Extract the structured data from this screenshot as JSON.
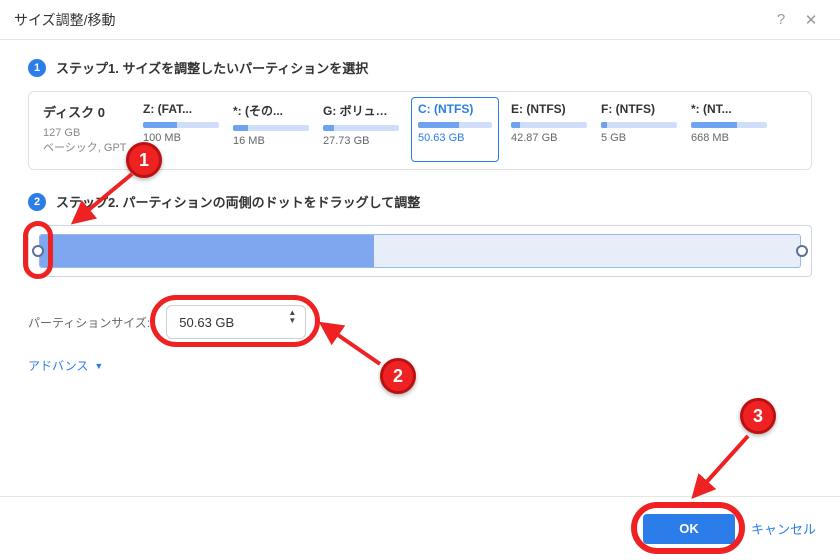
{
  "window": {
    "title": "サイズ調整/移動"
  },
  "step1": {
    "num": "1",
    "label": "ステップ1. サイズを調整したいパーティションを選択"
  },
  "disk": {
    "name": "ディスク 0",
    "size": "127 GB",
    "type": "ベーシック, GPT"
  },
  "partitions": [
    {
      "label": "Z: (FAT...",
      "size": "100 MB",
      "fill": 45
    },
    {
      "label": "*: (その...",
      "size": "16 MB",
      "fill": 20
    },
    {
      "label": "G: ボリューム(...",
      "size": "27.73 GB",
      "fill": 15
    },
    {
      "label": "C: (NTFS)",
      "size": "50.63 GB",
      "fill": 55,
      "selected": true
    },
    {
      "label": "E: (NTFS)",
      "size": "42.87 GB",
      "fill": 12
    },
    {
      "label": "F: (NTFS)",
      "size": "5 GB",
      "fill": 8
    },
    {
      "label": "*: (NT...",
      "size": "668 MB",
      "fill": 60
    }
  ],
  "step2": {
    "num": "2",
    "label": "ステップ2. パーティションの両側のドットをドラッグして調整"
  },
  "sizeField": {
    "label": "パーティションサイズ:",
    "value": "50.63 GB"
  },
  "advanced": "アドバンス",
  "buttons": {
    "ok": "OK",
    "cancel": "キャンセル"
  },
  "callouts": {
    "n1": "1",
    "n2": "2",
    "n3": "3"
  }
}
